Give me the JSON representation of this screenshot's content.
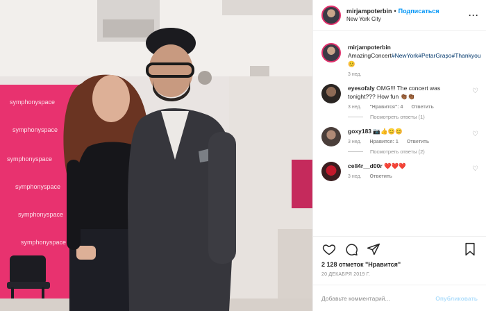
{
  "header": {
    "username": "mirjampoterbin",
    "separator": "•",
    "follow_label": "Подписаться",
    "location": "New York City",
    "more_label": "···"
  },
  "caption": {
    "username": "mirjampoterbin",
    "text_prefix": "AmazingConcert",
    "tags": [
      "#NewYork",
      "#PetarGrașo",
      "#Thankyou"
    ],
    "emoji": "😊",
    "time": "3 нед."
  },
  "comments": [
    {
      "username": "eyesofaly",
      "text": "OMG!!! The concert was tonight??? How fun 👏🏾👏🏾",
      "time": "3 нед.",
      "likes": "\"Нравится\": 4",
      "reply_label": "Ответить",
      "replies_label": "Посмотреть ответы (1)"
    },
    {
      "username": "goxy183",
      "text": "📷👍😊😊",
      "time": "3 нед.",
      "likes": "Нравится: 1",
      "reply_label": "Ответить",
      "replies_label": "Посмотреть ответы (2)"
    },
    {
      "username": "cell4r__d00r",
      "text": "❤️❤️❤️",
      "time": "3 нед.",
      "reply_label": "Ответить"
    }
  ],
  "likes_text": "2 128 отметок \"Нравится\"",
  "date_text": "20 ДЕКАБРЯ 2019 Г.",
  "add_comment_placeholder": "Добавьте комментарий...",
  "post_label": "Опубликовать",
  "photo_wall_text": [
    "symphonyspace",
    "symphonyspace",
    "symphonyspace",
    "symphonyspace",
    "symphonyspace",
    "symphonyspace"
  ],
  "colors": {
    "accent_link": "#0095f6",
    "hashtag": "#00376b",
    "muted": "#8e8e8e",
    "wall_magenta": "#e8326f"
  }
}
